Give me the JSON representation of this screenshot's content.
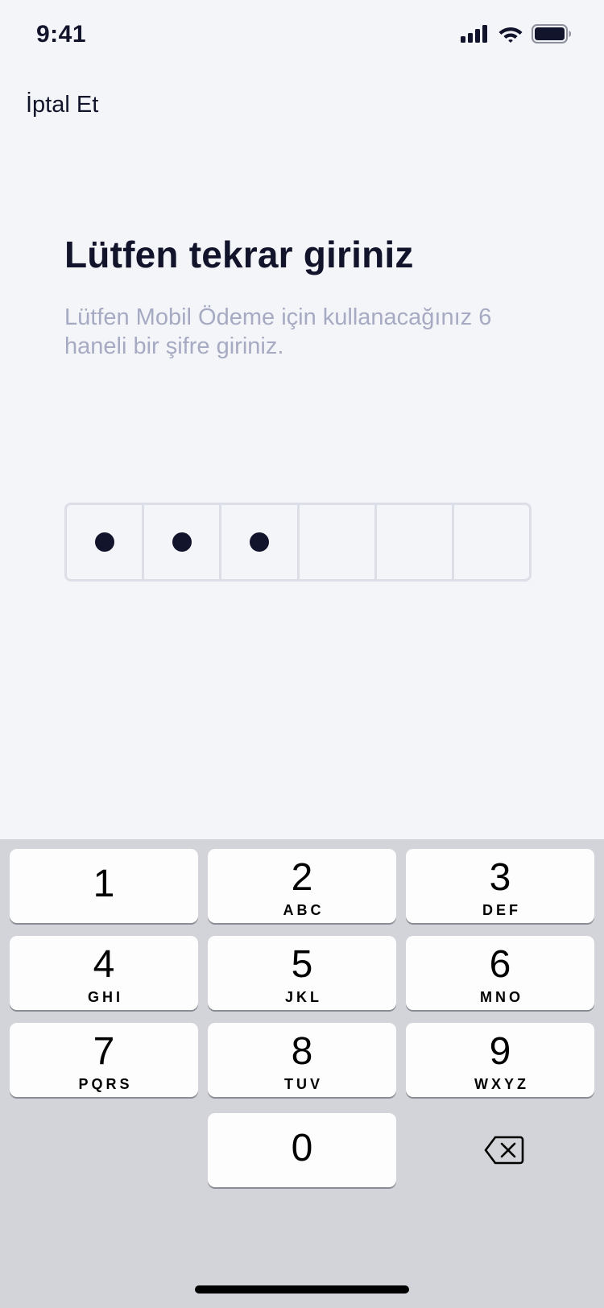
{
  "status_bar": {
    "time": "9:41",
    "icons": [
      "signal-icon",
      "wifi-icon",
      "battery-icon"
    ]
  },
  "header": {
    "cancel_label": "İptal Et"
  },
  "main": {
    "title": "Lütfen tekrar giriniz",
    "subtitle": "Lütfen Mobil Ödeme için kullanacağınız 6 haneli bir şifre giriniz."
  },
  "pin": {
    "length": 6,
    "filled": 3
  },
  "keypad": {
    "keys": [
      {
        "digit": "1",
        "letters": ""
      },
      {
        "digit": "2",
        "letters": "ABC"
      },
      {
        "digit": "3",
        "letters": "DEF"
      },
      {
        "digit": "4",
        "letters": "GHI"
      },
      {
        "digit": "5",
        "letters": "JKL"
      },
      {
        "digit": "6",
        "letters": "MNO"
      },
      {
        "digit": "7",
        "letters": "PQRS"
      },
      {
        "digit": "8",
        "letters": "TUV"
      },
      {
        "digit": "9",
        "letters": "WXYZ"
      },
      {
        "digit": "0",
        "letters": ""
      }
    ],
    "delete_icon": "backspace-icon"
  },
  "colors": {
    "background": "#f4f5f9",
    "title": "#11142b",
    "subtitle": "#a6aac2",
    "keyboard_bg": "#d2d4d9",
    "key_bg": "#fdfdfe"
  }
}
